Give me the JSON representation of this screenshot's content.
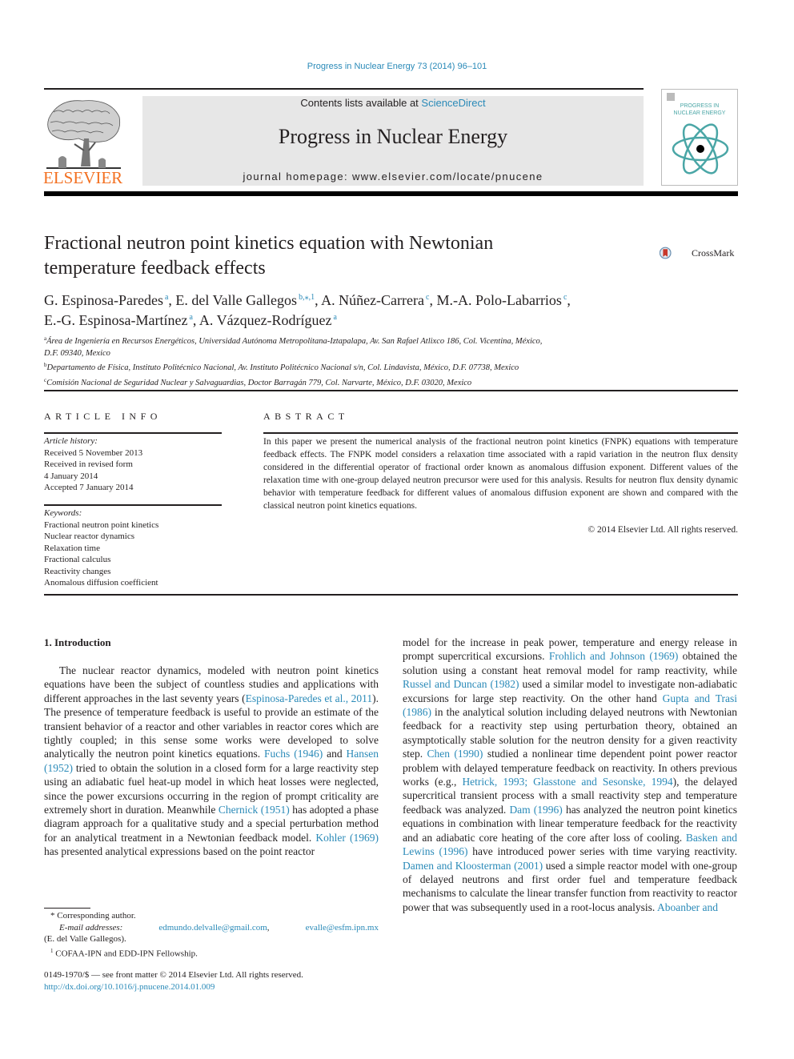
{
  "header": {
    "citation": "Progress in Nuclear Energy 73 (2014) 96–101",
    "contents_prefix": "Contents lists available at ",
    "contents_link": "ScienceDirect",
    "journal_name": "Progress in Nuclear Energy",
    "homepage": "journal homepage: www.elsevier.com/locate/pnucene",
    "publisher_logo_text": "ELSEVIER",
    "cover_title_line1": "PROGRESS IN",
    "cover_title_line2": "NUCLEAR ENERGY",
    "crossmark_label": "CrossMark"
  },
  "colors": {
    "link": "#2a8ab8",
    "elsevier_orange": "#f37021",
    "banner_gray": "#e7e7e7",
    "cover_teal": "#4aa6a6",
    "crossmark_red": "#c8382a"
  },
  "article": {
    "title_line1": "Fractional neutron point kinetics equation with Newtonian",
    "title_line2": "temperature feedback effects",
    "authors": [
      {
        "name": "G. Espinosa-Paredes",
        "sup": "a",
        "sep": ", "
      },
      {
        "name": "E. del Valle Gallegos",
        "sup": "b,⁎,1",
        "sep": ", "
      },
      {
        "name": "A. Núñez-Carrera",
        "sup": "c",
        "sep": ", "
      },
      {
        "name": "M.-A. Polo-Labarrios",
        "sup": "c",
        "sep": ","
      },
      {
        "name": "E.-G. Espinosa-Martínez",
        "sup": "a",
        "sep": ", "
      },
      {
        "name": "A. Vázquez-Rodríguez",
        "sup": "a",
        "sep": ""
      }
    ],
    "affiliations": [
      {
        "sup": "a",
        "line1": "Área de Ingeniería en Recursos Energéticos, Universidad Autónoma Metropolitana-Iztapalapa, Av. San Rafael Atlixco 186, Col. Vicentina, México,",
        "line2": "D.F. 09340, Mexico"
      },
      {
        "sup": "b",
        "line1": "Departamento de Física, Instituto Politécnico Nacional, Av. Instituto Politécnico Nacional s/n, Col. Lindavista, México, D.F. 07738, Mexico",
        "line2": ""
      },
      {
        "sup": "c",
        "line1": "Comisión Nacional de Seguridad Nuclear y Salvaguardias, Doctor Barragán 779, Col. Narvarte, México, D.F. 03020, Mexico",
        "line2": ""
      }
    ]
  },
  "article_info": {
    "heading": "ARTICLE INFO",
    "history_label": "Article history:",
    "history": [
      "Received 5 November 2013",
      "Received in revised form",
      "4 January 2014",
      "Accepted 7 January 2014"
    ],
    "keywords_label": "Keywords:",
    "keywords": [
      "Fractional neutron point kinetics",
      "Nuclear reactor dynamics",
      "Relaxation time",
      "Fractional calculus",
      "Reactivity changes",
      "Anomalous diffusion coefficient"
    ]
  },
  "abstract": {
    "heading": "ABSTRACT",
    "text": "In this paper we present the numerical analysis of the fractional neutron point kinetics (FNPK) equations with temperature feedback effects. The FNPK model considers a relaxation time associated with a rapid variation in the neutron flux density considered in the differential operator of fractional order known as anomalous diffusion exponent. Different values of the relaxation time with one-group delayed neutron precursor were used for this analysis. Results for neutron flux density dynamic behavior with temper­ature feedback for different values of anomalous diffusion exponent are shown and compared with the classical neutron point kinetics equations.",
    "copyright": "© 2014 Elsevier Ltd. All rights reserved."
  },
  "introduction": {
    "heading": "1.  Introduction",
    "left_segments": [
      {
        "t": "The nuclear reactor dynamics, modeled with neutron point ki­netics equations have been the subject of countless studies and applications with different approaches in the last seventy years ("
      },
      {
        "l": "Espinosa-Paredes et al., 2011"
      },
      {
        "t": "). The presence of temperature feed­back is useful to provide an estimate of the transient behavior of a reactor and other variables in reactor cores which are tightly coupled; in this sense some works were developed to solve analytically the neutron point kinetics equations. "
      },
      {
        "l": "Fuchs (1946)"
      },
      {
        "t": " and "
      },
      {
        "l": "Hansen (1952)"
      },
      {
        "t": " tried to obtain the solution in a closed form for a large reactivity step using an adiabatic fuel heat-up model in which heat losses were neglected, since the power excursions occurring in the region of prompt criticality are extremely short in duration. Meanwhile "
      },
      {
        "l": "Chernick (1951)"
      },
      {
        "t": " has adopted a phase diagram approach for a qualitative study and a special perturbation method for an analytical treatment in a Newtonian feedback model. "
      },
      {
        "l": "Kohler (1969)"
      },
      {
        "t": " has presented analytical expressions based on the point reactor"
      }
    ],
    "right_segments": [
      {
        "t": "model for the increase in peak power, temperature and energy release in prompt supercritical excursions. "
      },
      {
        "l": "Frohlich and Johnson (1969)"
      },
      {
        "t": " obtained the solution using a constant heat removal model for ramp reactivity, while "
      },
      {
        "l": "Russel and Duncan (1982)"
      },
      {
        "t": " used a similar model to investigate non-adiabatic excursions for large step reactivity. On the other hand "
      },
      {
        "l": "Gupta and Trasi (1986)"
      },
      {
        "t": " in the analytical solution including delayed neutrons with Newtonian feedback for a reactivity step using perturbation theory, obtained an asymptotically stable solution for the neutron density for a given reactivity step. "
      },
      {
        "l": "Chen (1990)"
      },
      {
        "t": " studied a nonlinear time dependent point power reactor problem with delayed temperature feedback on reactivity. In others previous works (e.g., "
      },
      {
        "l": "Hetrick, 1993; Glasstone and Sesonske, 1994"
      },
      {
        "t": "), the delayed supercritical transient process with a small reactivity step and temperature feedback was analyzed. "
      },
      {
        "l": "Dam (1996)"
      },
      {
        "t": " has analyzed the neutron point kinetics equations in combination with linear temperature feedback for the reactivity and an adiabatic core heating of the core after loss of cooling. "
      },
      {
        "l": "Basken and Lewins (1996)"
      },
      {
        "t": " have introduced power series with time varying reactivity. "
      },
      {
        "l": "Damen and Kloosterman (2001)"
      },
      {
        "t": " used a simple reactor model with one-group of delayed neutrons and first order fuel and temperature feedback mechanisms to calculate the linear transfer function from reactivity to reactor power that was subsequently used in a root-locus analysis. "
      },
      {
        "l": "Aboanber and"
      }
    ]
  },
  "footnotes": {
    "corresponding_mark": "*",
    "corresponding": "Corresponding author.",
    "email_label": "E-mail addresses:",
    "email1": "edmundo.delvalle@gmail.com",
    "email_sep": ",",
    "email2": "evalle@esfm.ipn.mx",
    "email_owner": "(E. del Valle Gallegos).",
    "fellowship_mark": "1",
    "fellowship": "COFAA-IPN and EDD-IPN Fellowship.",
    "issn": "0149-1970/$ — see front matter © 2014 Elsevier Ltd. All rights reserved.",
    "doi": "http://dx.doi.org/10.1016/j.pnucene.2014.01.009"
  }
}
